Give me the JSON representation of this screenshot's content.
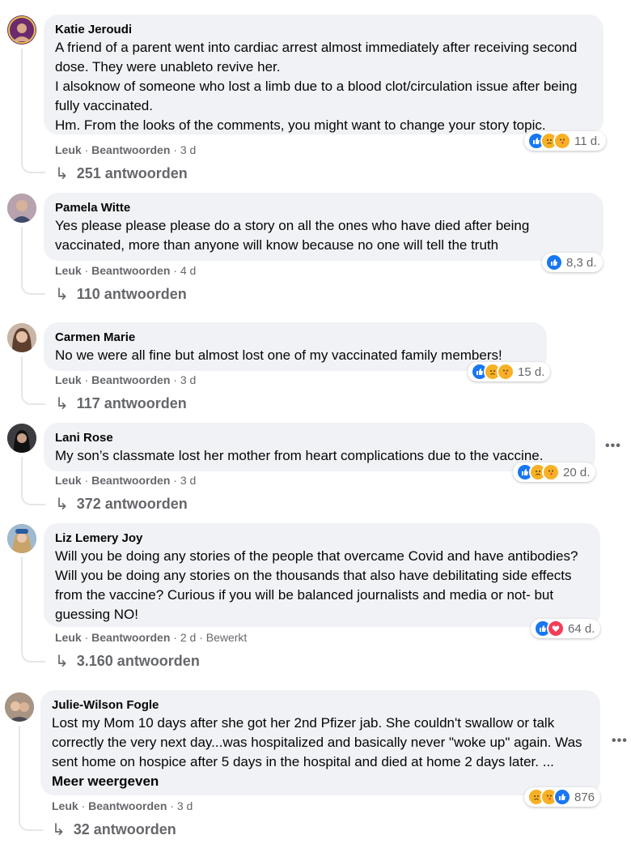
{
  "comments": [
    {
      "author": "Katie Jeroudi",
      "text": "A friend of a parent went into cardiac arrest almost immediately after receiving second dose. They were unableto revive her.\nI alsoknow of someone who lost a limb due to a blood clot/circulation issue after being fully vaccinated.\nHm. From the looks of the comments, you might want to change your story topic.",
      "like": "Leuk",
      "reply": "Beantwoorden",
      "time": "3 d",
      "reaction_count": "11 d.",
      "reaction_icons": [
        "like-icon",
        "sad-icon",
        "care-icon"
      ],
      "replies": "251 antwoorden",
      "avatar_color": "#6b2a6e"
    },
    {
      "author": "Pamela Witte",
      "text": "Yes please please please do a story on all the ones who have died after being vaccinated, more than anyone will know because no one will tell the truth",
      "like": "Leuk",
      "reply": "Beantwoorden",
      "time": "4 d",
      "reaction_count": "8,3 d.",
      "reaction_icons": [
        "like-icon"
      ],
      "replies": "110 antwoorden",
      "avatar_color": "#8a7a84"
    },
    {
      "author": "Carmen Marie",
      "text": "No we were all fine but almost lost one of my vaccinated family members!",
      "like": "Leuk",
      "reply": "Beantwoorden",
      "time": "3 d",
      "reaction_count": "15 d.",
      "reaction_icons": [
        "like-icon",
        "sad-icon",
        "care-icon"
      ],
      "replies": "117 antwoorden",
      "avatar_color": "#a08270"
    },
    {
      "author": "Lani Rose",
      "text": "My son’s classmate lost her mother from heart complications due to the vaccine.",
      "like": "Leuk",
      "reply": "Beantwoorden",
      "time": "3 d",
      "reaction_count": "20 d.",
      "reaction_icons": [
        "like-icon",
        "sad-icon",
        "care-icon"
      ],
      "replies": "372 antwoorden",
      "avatar_color": "#2f2f33",
      "has_menu": true
    },
    {
      "author": "Liz Lemery Joy",
      "text": "Will you be doing any stories of the people that overcame Covid and have antibodies? Will you be doing any stories on the thousands that also have debilitating side effects from the vaccine? Curious if you will be balanced journalists and media or not- but guessing NO!",
      "like": "Leuk",
      "reply": "Beantwoorden",
      "time": "2 d",
      "edited": "Bewerkt",
      "reaction_count": "64 d.",
      "reaction_icons": [
        "like-icon",
        "love-icon"
      ],
      "replies": "3.160 antwoorden",
      "avatar_color": "#5e86a8"
    },
    {
      "author": "Julie-Wilson Fogle",
      "text": "Lost my Mom 10 days after she got her 2nd Pfizer jab. She couldn't swallow or talk correctly the very next day...was hospitalized and basically never \"woke up\" again. Was sent home on hospice after 5 days in the hospital and died at home 2 days later. ...",
      "more": "Meer weergeven",
      "like": "Leuk",
      "reply": "Beantwoorden",
      "time": "3 d",
      "reaction_count": "876",
      "reaction_icons": [
        "sad-icon",
        "care-icon",
        "like-icon"
      ],
      "replies": "32 antwoorden",
      "avatar_color": "#7a6558",
      "has_menu": true
    }
  ],
  "menu_glyph": "•••",
  "reply_arrow": "↳",
  "separator": "·"
}
